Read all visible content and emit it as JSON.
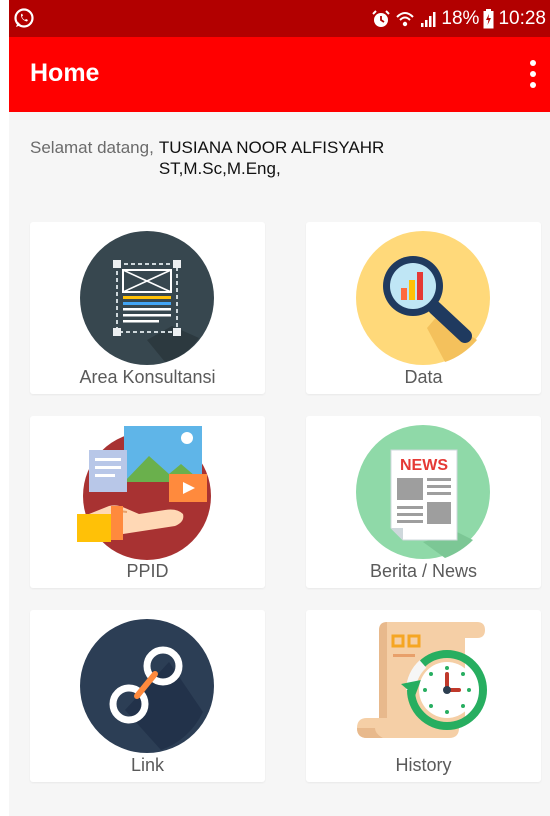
{
  "status_bar": {
    "battery": "18%",
    "time": "10:28",
    "icons": [
      "whatsapp-icon",
      "alarm-icon",
      "wifi-icon",
      "signal-icon",
      "battery-icon"
    ]
  },
  "app_bar": {
    "title": "Home",
    "menu_icon": "more-vert-icon"
  },
  "welcome": {
    "prefix": "Selamat datang,",
    "name": "TUSIANA NOOR ALFISYAHR ST,M.Sc,M.Eng,"
  },
  "menu_items": [
    {
      "label": "Area Konsultansi",
      "icon": "document-frame-icon"
    },
    {
      "label": "Data",
      "icon": "magnifier-chart-icon"
    },
    {
      "label": "PPID",
      "icon": "info-presentation-icon"
    },
    {
      "label": "Berita / News",
      "icon": "newspaper-icon"
    },
    {
      "label": "Link",
      "icon": "chain-link-icon"
    },
    {
      "label": "History",
      "icon": "scroll-clock-icon"
    }
  ],
  "colors": {
    "status_bar": "#b20000",
    "app_bar": "#ff0000",
    "background": "#f6f6f6",
    "card": "#ffffff"
  }
}
